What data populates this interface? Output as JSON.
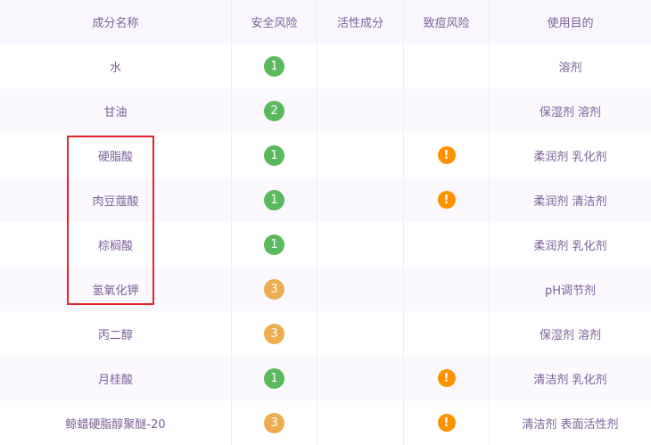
{
  "headers": [
    "成分名称",
    "安全风险",
    "活性成分",
    "致痘风险",
    "使用目的"
  ],
  "colors": {
    "risk_low": "#5cb85c",
    "risk_mid": "#edad4f",
    "acne": "#fb9200",
    "highlight": "#e0252a"
  },
  "rows": [
    {
      "name": "水",
      "safety": "1",
      "active": "",
      "acne": false,
      "purpose": "溶剂"
    },
    {
      "name": "甘油",
      "safety": "2",
      "active": "",
      "acne": false,
      "purpose": "保湿剂 溶剂"
    },
    {
      "name": "硬脂酸",
      "safety": "1",
      "active": "",
      "acne": true,
      "purpose": "柔润剂 乳化剂"
    },
    {
      "name": "肉豆蔻酸",
      "safety": "1",
      "active": "",
      "acne": true,
      "purpose": "柔润剂 清洁剂"
    },
    {
      "name": "棕榈酸",
      "safety": "1",
      "active": "",
      "acne": false,
      "purpose": "柔润剂 乳化剂"
    },
    {
      "name": "氢氧化钾",
      "safety": "3",
      "active": "",
      "acne": false,
      "purpose": "pH调节剂"
    },
    {
      "name": "丙二醇",
      "safety": "3",
      "active": "",
      "acne": false,
      "purpose": "保湿剂 溶剂"
    },
    {
      "name": "月桂酸",
      "safety": "1",
      "active": "",
      "acne": true,
      "purpose": "清洁剂 乳化剂"
    },
    {
      "name": "鲸蜡硬脂醇聚醚-20",
      "safety": "3",
      "active": "",
      "acne": true,
      "purpose": "清洁剂 表面活性剂"
    }
  ],
  "acne_icon": "!"
}
